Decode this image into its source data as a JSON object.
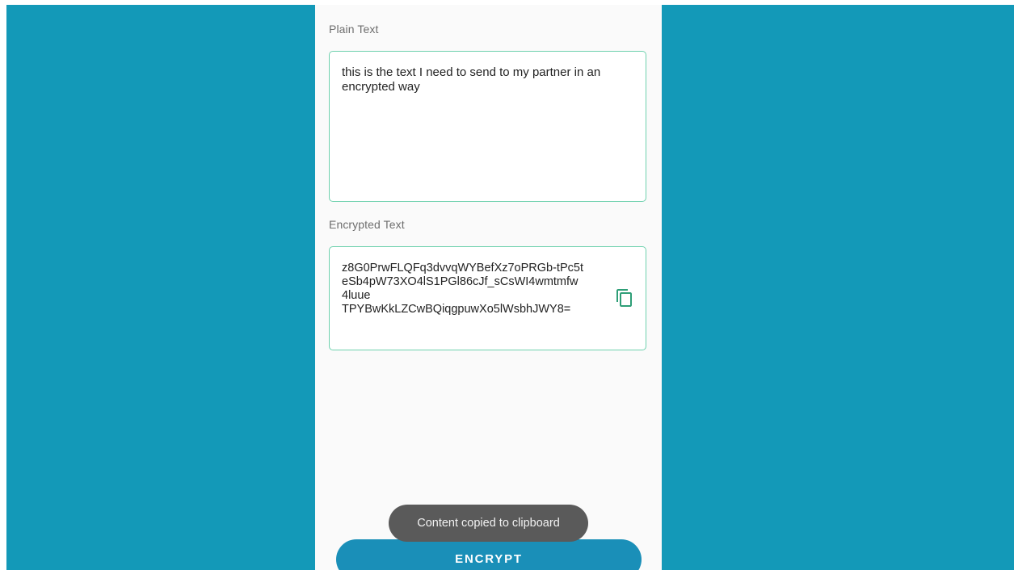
{
  "form": {
    "plain_label": "Plain Text",
    "plain_value_lines": [
      "this is the text I need to send to my partner in an",
      "encrypted way"
    ],
    "encrypted_label": "Encrypted Text",
    "encrypted_lines": [
      "z8G0PrwFLQFq3dvvqWYBefXz7oPRGb-tPc5t",
      "eSb4pW73XO4lS1PGl86cJf_sCsWI4wmtmfw",
      "4luue",
      "TPYBwKkLZCwBQiqgpuwXo5lWsbhJWY8="
    ],
    "copy_icon": "content-copy-icon"
  },
  "toast": {
    "message": "Content copied to clipboard"
  },
  "actions": {
    "encrypt_label": "ENCRYPT"
  },
  "colors": {
    "background": "#1399b8",
    "accent_border": "#6fd1ae",
    "icon_green": "#2e9e77",
    "button": "#1a8fb8",
    "toast": "#5a5a5a"
  }
}
